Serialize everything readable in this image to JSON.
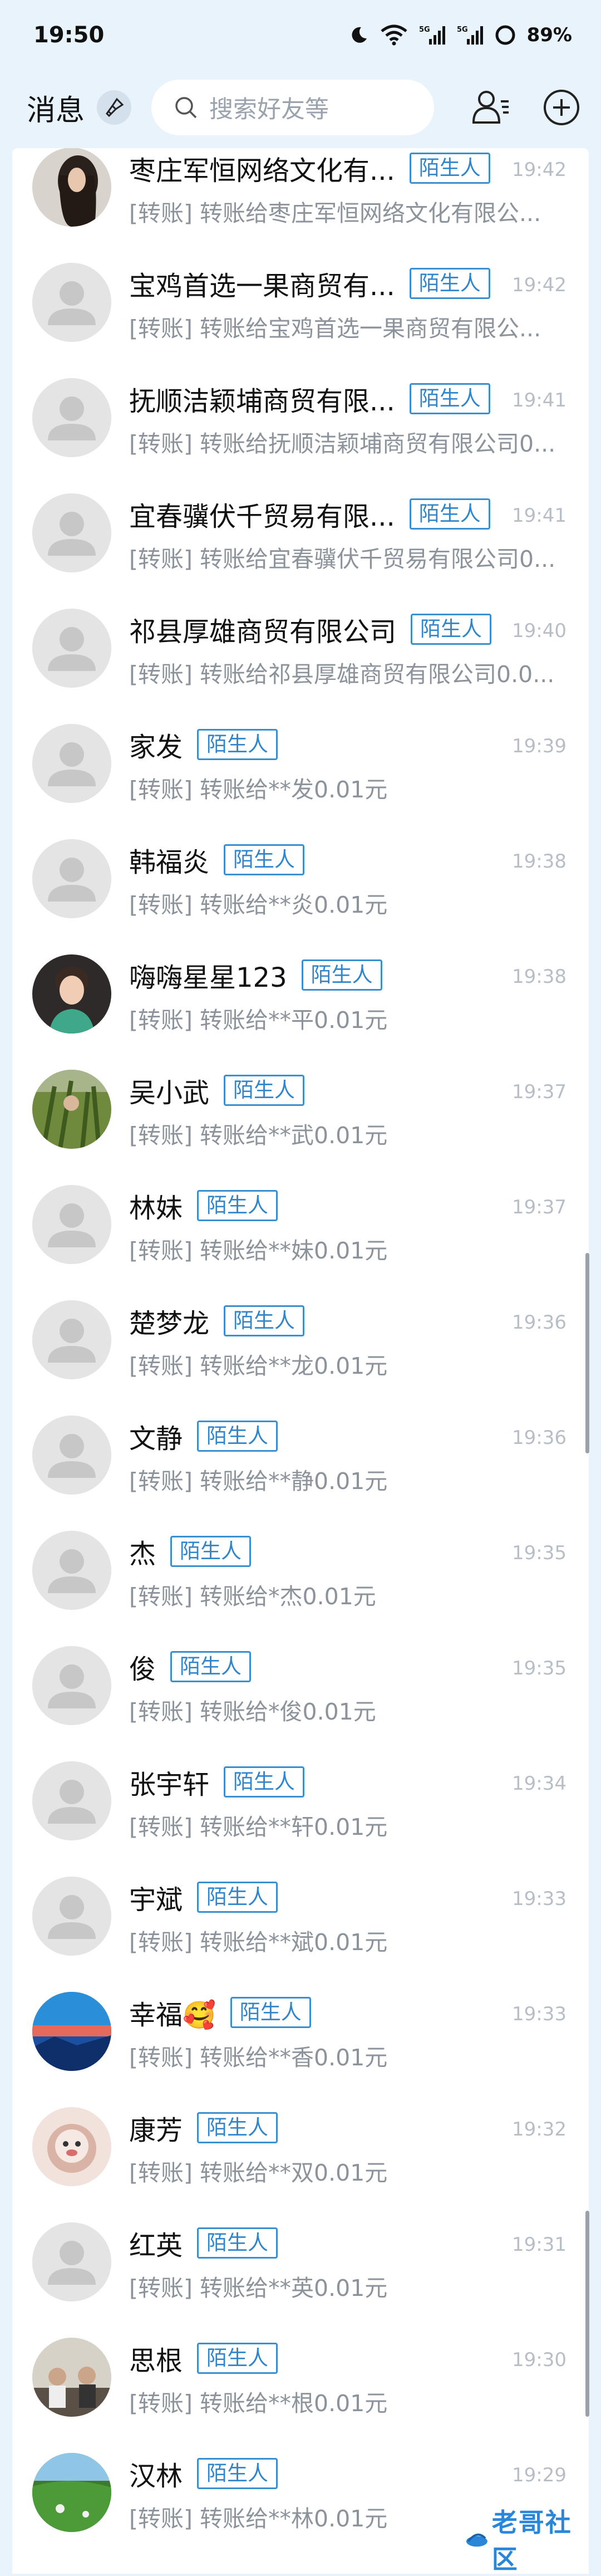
{
  "status_bar": {
    "time": "19:50",
    "battery": "89%",
    "network_1": "5G",
    "network_2": "5G"
  },
  "header": {
    "title": "消息",
    "search_placeholder": "搜索好友等"
  },
  "colors": {
    "accent": "#2f86cc",
    "background": "#e9f3fb"
  },
  "conversations": [
    {
      "name": "枣庄军恒网络文化有...",
      "badge": "陌生人",
      "time": "19:42",
      "preview": "[转账] 转账给枣庄军恒网络文化有限公...",
      "avatar": "photo-long-hair"
    },
    {
      "name": "宝鸡首选一果商贸有...",
      "badge": "陌生人",
      "time": "19:42",
      "preview": "[转账] 转账给宝鸡首选一果商贸有限公...",
      "avatar": "default-avatar"
    },
    {
      "name": "抚顺洁颖埔商贸有限...",
      "badge": "陌生人",
      "time": "19:41",
      "preview": "[转账] 转账给抚顺洁颖埔商贸有限公司0...",
      "avatar": "default-avatar"
    },
    {
      "name": "宜春骥伏千贸易有限...",
      "badge": "陌生人",
      "time": "19:41",
      "preview": "[转账] 转账给宜春骥伏千贸易有限公司0...",
      "avatar": "default-avatar"
    },
    {
      "name": "祁县厚雄商贸有限公司",
      "badge": "陌生人",
      "time": "19:40",
      "preview": "[转账] 转账给祁县厚雄商贸有限公司0.0...",
      "avatar": "default-avatar"
    },
    {
      "name": "家发",
      "badge": "陌生人",
      "time": "19:39",
      "preview": "[转账] 转账给**发0.01元",
      "avatar": "default-avatar"
    },
    {
      "name": "韩福炎",
      "badge": "陌生人",
      "time": "19:38",
      "preview": "[转账] 转账给**炎0.01元",
      "avatar": "default-avatar"
    },
    {
      "name": "嗨嗨星星123",
      "badge": "陌生人",
      "time": "19:38",
      "preview": "[转账] 转账给**平0.01元",
      "avatar": "photo-portrait"
    },
    {
      "name": "吴小武",
      "badge": "陌生人",
      "time": "19:37",
      "preview": "[转账] 转账给**武0.01元",
      "avatar": "photo-grass"
    },
    {
      "name": "林妹",
      "badge": "陌生人",
      "time": "19:37",
      "preview": "[转账] 转账给**妹0.01元",
      "avatar": "default-avatar"
    },
    {
      "name": "楚梦龙",
      "badge": "陌生人",
      "time": "19:36",
      "preview": "[转账] 转账给**龙0.01元",
      "avatar": "default-avatar"
    },
    {
      "name": "文静",
      "badge": "陌生人",
      "time": "19:36",
      "preview": "[转账] 转账给**静0.01元",
      "avatar": "default-avatar"
    },
    {
      "name": "杰",
      "badge": "陌生人",
      "time": "19:35",
      "preview": "[转账] 转账给*杰0.01元",
      "avatar": "default-avatar"
    },
    {
      "name": "俊",
      "badge": "陌生人",
      "time": "19:35",
      "preview": "[转账] 转账给*俊0.01元",
      "avatar": "default-avatar"
    },
    {
      "name": "张宇轩",
      "badge": "陌生人",
      "time": "19:34",
      "preview": "[转账] 转账给**轩0.01元",
      "avatar": "default-avatar"
    },
    {
      "name": "宇斌",
      "badge": "陌生人",
      "time": "19:33",
      "preview": "[转账] 转账给**斌0.01元",
      "avatar": "default-avatar"
    },
    {
      "name": "幸福🥰",
      "badge": "陌生人",
      "time": "19:33",
      "preview": "[转账] 转账给**香0.01元",
      "avatar": "photo-sunset"
    },
    {
      "name": "康芳",
      "badge": "陌生人",
      "time": "19:32",
      "preview": "[转账] 转账给**双0.01元",
      "avatar": "photo-cartoon"
    },
    {
      "name": "红英",
      "badge": "陌生人",
      "time": "19:31",
      "preview": "[转账] 转账给**英0.01元",
      "avatar": "default-avatar"
    },
    {
      "name": "思根",
      "badge": "陌生人",
      "time": "19:30",
      "preview": "[转账] 转账给**根0.01元",
      "avatar": "photo-group"
    },
    {
      "name": "汉林",
      "badge": "陌生人",
      "time": "19:29",
      "preview": "[转账] 转账给**林0.01元",
      "avatar": "photo-landscape"
    }
  ],
  "watermark": {
    "text": "老哥社区"
  }
}
